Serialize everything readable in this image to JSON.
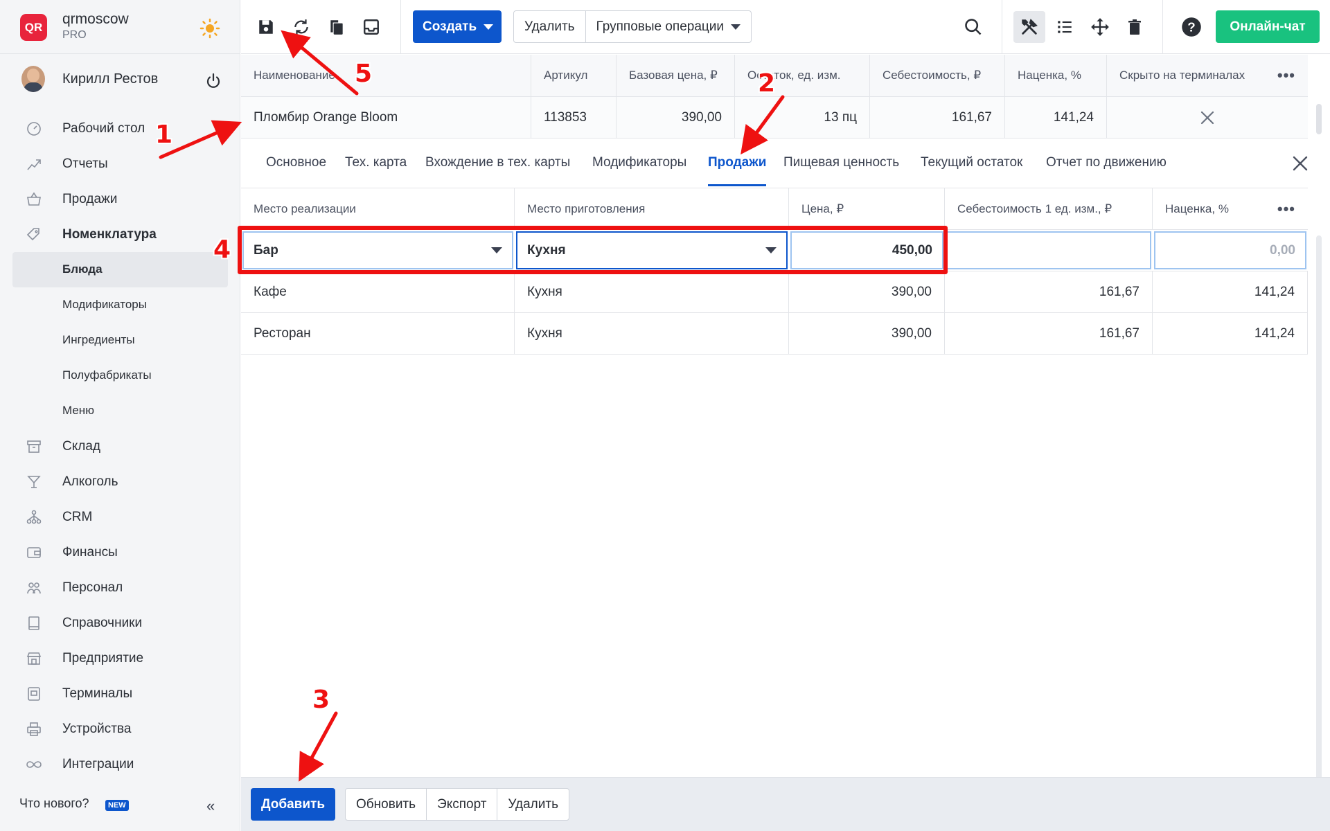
{
  "brand": {
    "name": "qrmoscow",
    "plan": "PRO",
    "logo_text": "QR"
  },
  "user": {
    "name": "Кирилл Рестов"
  },
  "nav": [
    {
      "label": "Рабочий стол",
      "icon": "dashboard-icon"
    },
    {
      "label": "Отчеты",
      "icon": "reports-icon"
    },
    {
      "label": "Продажи",
      "icon": "basket-icon"
    },
    {
      "label": "Номенклатура",
      "icon": "tag-icon"
    }
  ],
  "nav_sub": [
    "Блюда",
    "Модификаторы",
    "Ингредиенты",
    "Полуфабрикаты",
    "Меню"
  ],
  "nav_bottom": [
    {
      "label": "Склад",
      "icon": "warehouse-icon"
    },
    {
      "label": "Алкоголь",
      "icon": "cocktail-icon"
    },
    {
      "label": "CRM",
      "icon": "crm-icon"
    },
    {
      "label": "Финансы",
      "icon": "wallet-icon"
    },
    {
      "label": "Персонал",
      "icon": "staff-icon"
    },
    {
      "label": "Справочники",
      "icon": "book-icon"
    },
    {
      "label": "Предприятие",
      "icon": "store-icon"
    },
    {
      "label": "Терминалы",
      "icon": "terminal-icon"
    },
    {
      "label": "Устройства",
      "icon": "printer-icon"
    },
    {
      "label": "Интеграции",
      "icon": "infinity-icon"
    }
  ],
  "footer": {
    "whats_new": "Что нового?",
    "badge": "NEW"
  },
  "toolbar": {
    "create": "Создать",
    "delete": "Удалить",
    "group_ops": "Групповые операции",
    "chat": "Онлайн-чат"
  },
  "top_grid": {
    "headers": [
      "Наименование",
      "Артикул",
      "Базовая цена, ₽",
      "Остаток, ед. изм.",
      "Себестоимость, ₽",
      "Наценка, %",
      "Скрыто на терминалах"
    ],
    "row": [
      "Пломбир Orange Bloom",
      "113853",
      "390,00",
      "13 пц",
      "161,67",
      "141,24"
    ]
  },
  "tabs": [
    "Основное",
    "Тех. карта",
    "Вхождение в тех. карты",
    "Модификаторы",
    "Продажи",
    "Пищевая ценность",
    "Текущий остаток",
    "Отчет по движению"
  ],
  "active_tab": "Продажи",
  "sub_grid": {
    "headers": [
      "Место реализации",
      "Место приготовления",
      "Цена, ₽",
      "Себестоимость 1 ед. изм., ₽",
      "Наценка, %"
    ],
    "edit_row": [
      "Бар",
      "Кухня",
      "450,00",
      "",
      "0,00"
    ],
    "rows": [
      [
        "Кафе",
        "Кухня",
        "390,00",
        "161,67",
        "141,24"
      ],
      [
        "Ресторан",
        "Кухня",
        "390,00",
        "161,67",
        "141,24"
      ]
    ]
  },
  "bottom": {
    "add": "Добавить",
    "refresh": "Обновить",
    "export": "Экспорт",
    "delete": "Удалить"
  },
  "annotations": [
    "1",
    "2",
    "3",
    "4",
    "5"
  ],
  "colors": {
    "accent": "#0d56cc",
    "chat": "#19c27f",
    "annotation": "#ee1111",
    "logo": "#e8243c"
  }
}
